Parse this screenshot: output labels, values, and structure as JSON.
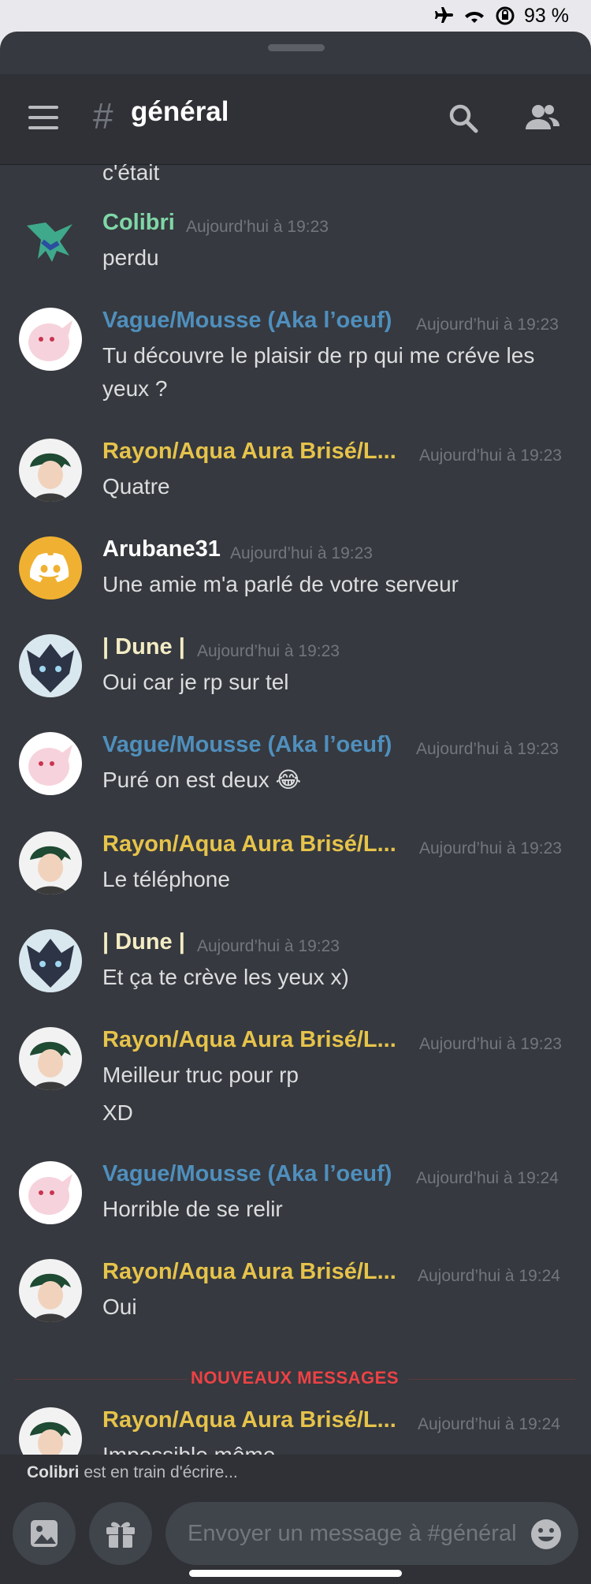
{
  "status_bar": {
    "battery": "93 %"
  },
  "header": {
    "hash": "#",
    "channel_name": "général"
  },
  "messages": [
    {
      "author": "Colibri",
      "time": "Aujourd’hui à 19:23",
      "lines": [
        "perdu"
      ]
    },
    {
      "author": "Vague/Mousse (Aka l’oeuf)",
      "time": "Aujourd’hui à 19:23",
      "lines": [
        "Tu découvre le plaisir de rp qui me créve les",
        "yeux ?"
      ]
    },
    {
      "author": "Rayon/Aqua Aura Brisé/L...",
      "time": "Aujourd’hui à 19:23",
      "lines": [
        "Quatre"
      ]
    },
    {
      "author": "Arubane31",
      "time": "Aujourd’hui à 19:23",
      "lines": [
        "Une amie m'a parlé de votre serveur"
      ]
    },
    {
      "author": "| Dune |",
      "time": "Aujourd’hui à 19:23",
      "lines": [
        "Oui car je rp sur tel"
      ]
    },
    {
      "author": "Vague/Mousse (Aka l’oeuf)",
      "time": "Aujourd’hui à 19:23",
      "lines": [
        "Puré on est deux 😂"
      ]
    },
    {
      "author": "Rayon/Aqua Aura Brisé/L...",
      "time": "Aujourd’hui à 19:23",
      "lines": [
        "Le téléphone"
      ]
    },
    {
      "author": "| Dune |",
      "time": "Aujourd’hui à 19:23",
      "lines": [
        "Et ça te crève les yeux x)"
      ]
    },
    {
      "author": "Rayon/Aqua Aura Brisé/L...",
      "time": "Aujourd’hui à 19:23",
      "lines": [
        "Meilleur truc pour rp",
        "XD"
      ]
    },
    {
      "author": "Vague/Mousse (Aka l’oeuf)",
      "time": "Aujourd’hui à 19:24",
      "lines": [
        "Horrible de se relir"
      ]
    },
    {
      "author": "Rayon/Aqua Aura Brisé/L...",
      "time": "Aujourd’hui à 19:24",
      "lines": [
        "Oui"
      ]
    },
    {
      "author": "Rayon/Aqua Aura Brisé/L...",
      "time": "Aujourd’hui à 19:24",
      "lines": [
        "Impossible même"
      ]
    }
  ],
  "partial_top_text": "c'était",
  "new_messages_label": "NOUVEAUX MESSAGES",
  "typing": {
    "user": "Colibri",
    "text": " est en train d'écrire..."
  },
  "composer": {
    "placeholder": "Envoyer un message à #général"
  },
  "colors": {
    "background": "#36393f",
    "header": "#2f3136",
    "new_messages": "#ed4245"
  }
}
